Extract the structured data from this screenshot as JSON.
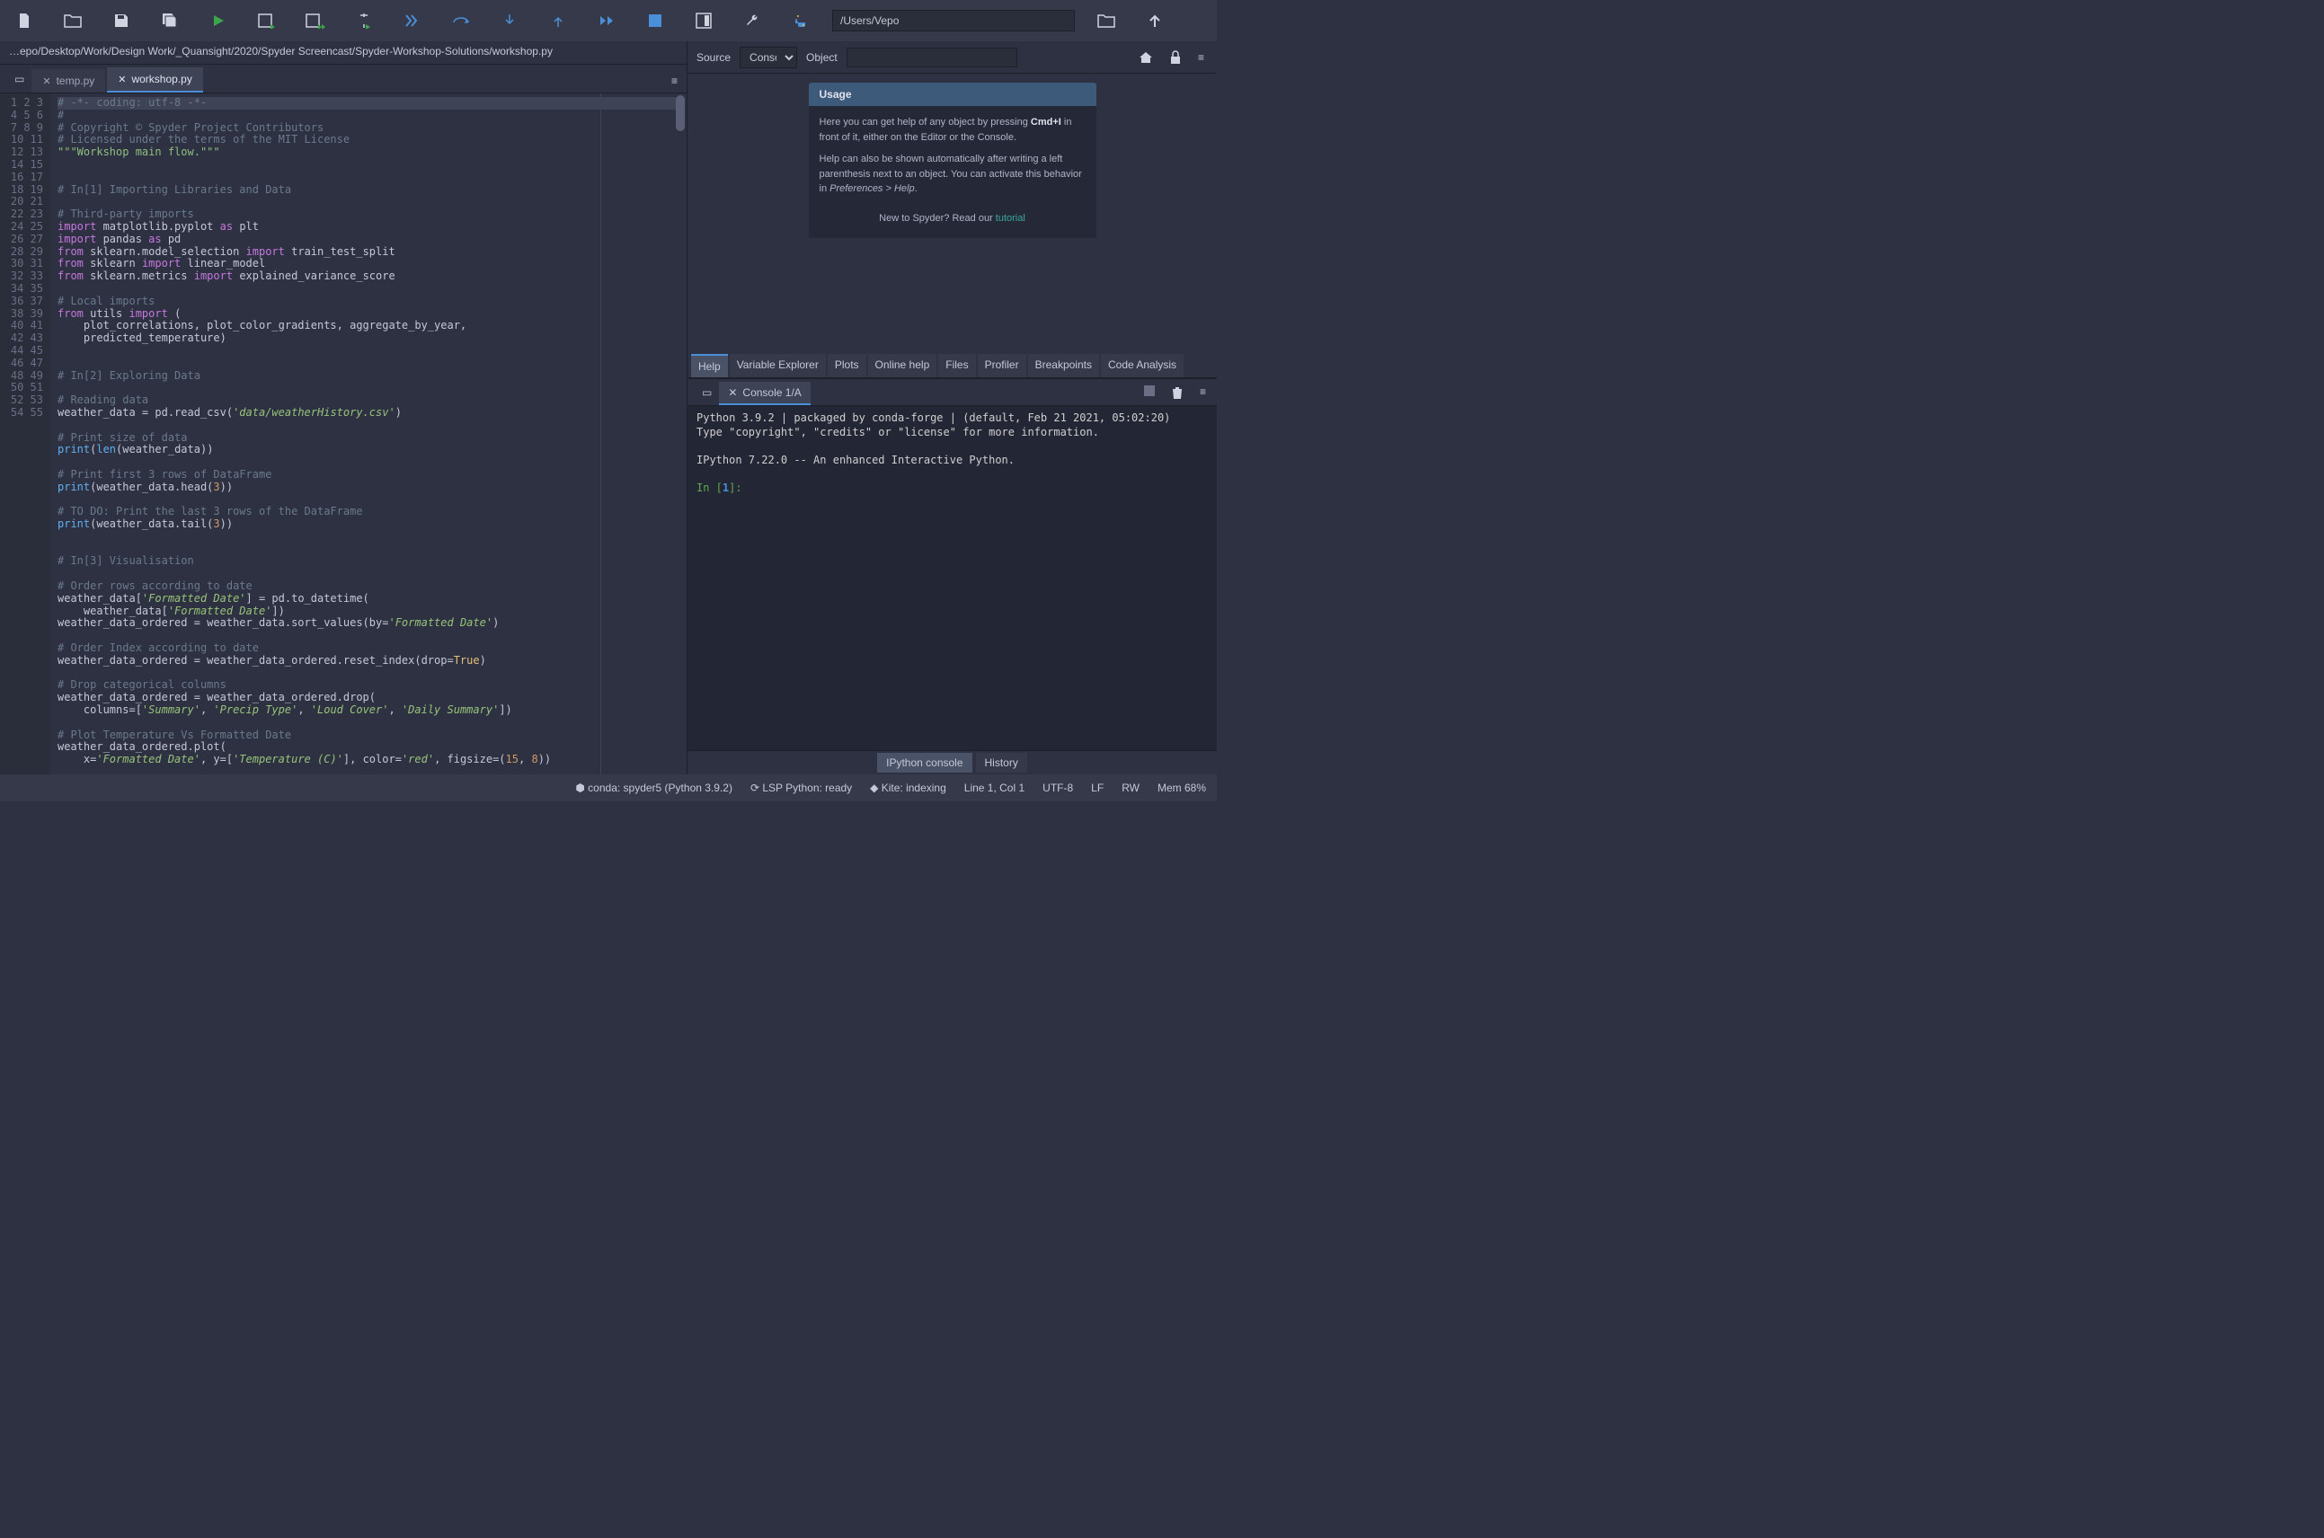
{
  "toolbar": {
    "path_value": "/Users/Vepo"
  },
  "breadcrumb": "…epo/Desktop/Work/Design Work/_Quansight/2020/Spyder Screencast/Spyder-Workshop-Solutions/workshop.py",
  "editor": {
    "tabs": [
      {
        "label": "temp.py",
        "active": false
      },
      {
        "label": "workshop.py",
        "active": true
      }
    ],
    "lines_start": 1,
    "lines_end": 55
  },
  "help_pane": {
    "source_label": "Source",
    "console_option": "Console",
    "object_label": "Object",
    "object_value": "",
    "card_title": "Usage",
    "para1_a": "Here you can get help of any object by pressing ",
    "para1_b": "Cmd+I",
    "para1_c": " in front of it, either on the Editor or the Console.",
    "para2_a": "Help can also be shown automatically after writing a left parenthesis next to an object. You can activate this behavior in ",
    "para2_b": "Preferences > Help",
    "tutorial_pre": "New to Spyder? Read our ",
    "tutorial_link": "tutorial",
    "tabs": [
      "Help",
      "Variable Explorer",
      "Plots",
      "Online help",
      "Files",
      "Profiler",
      "Breakpoints",
      "Code Analysis"
    ]
  },
  "console": {
    "tab_label": "Console 1/A",
    "banner_line1": "Python 3.9.2 | packaged by conda-forge | (default, Feb 21 2021, 05:02:20)",
    "banner_line2": "Type \"copyright\", \"credits\" or \"license\" for more information.",
    "banner_line3": "IPython 7.22.0 -- An enhanced Interactive Python.",
    "prompt_in": "In [",
    "prompt_num": "1",
    "prompt_close": "]:",
    "bottom_tabs": [
      "IPython console",
      "History"
    ]
  },
  "statusbar": {
    "conda": "conda: spyder5 (Python 3.9.2)",
    "lsp": "LSP Python: ready",
    "kite": "Kite: indexing",
    "pos": "Line 1, Col 1",
    "enc": "UTF-8",
    "eol": "LF",
    "perm": "RW",
    "mem": "Mem 68%"
  }
}
